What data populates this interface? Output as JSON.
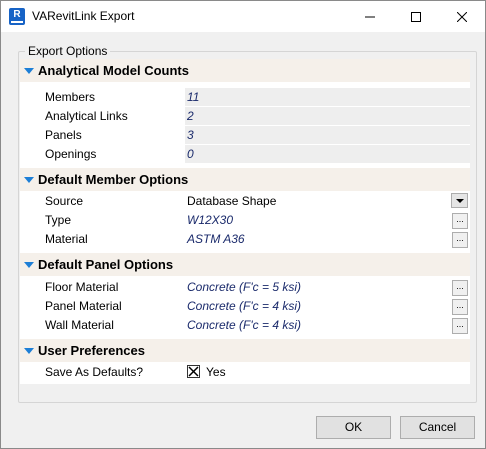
{
  "window": {
    "title": "VARevitLink Export",
    "app_icon_letter": "R"
  },
  "titlebar_buttons": {
    "minimize": "minimize",
    "maximize": "maximize",
    "close": "close"
  },
  "group": {
    "label": "Export Options"
  },
  "sections": {
    "counts": {
      "title": "Analytical Model Counts",
      "members_label": "Members",
      "members_value": "11",
      "links_label": "Analytical Links",
      "links_value": "2",
      "panels_label": "Panels",
      "panels_value": "3",
      "openings_label": "Openings",
      "openings_value": "0"
    },
    "member": {
      "title": "Default Member Options",
      "source_label": "Source",
      "source_value": "Database Shape",
      "type_label": "Type",
      "type_value": "W12X30",
      "material_label": "Material",
      "material_value": "ASTM A36"
    },
    "panel": {
      "title": "Default Panel Options",
      "floor_label": "Floor Material",
      "floor_value": "Concrete (F'c = 5 ksi)",
      "panel_label": "Panel Material",
      "panel_value": "Concrete (F'c = 4 ksi)",
      "wall_label": "Wall Material",
      "wall_value": "Concrete (F'c = 4 ksi)"
    },
    "prefs": {
      "title": "User Preferences",
      "save_label": "Save As Defaults?",
      "save_value": "Yes",
      "save_checked": true
    }
  },
  "ellipsis": "...",
  "buttons": {
    "ok": "OK",
    "cancel": "Cancel"
  },
  "colors": {
    "category_bg": "#f5f0ea",
    "arrow": "#1e7fd6",
    "value_text": "#1a2a6b",
    "readonly_bg": "#eeeeee"
  }
}
